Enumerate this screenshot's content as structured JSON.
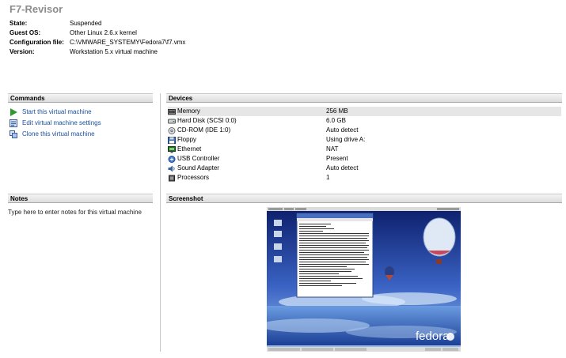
{
  "vm": {
    "name": "F7-Revisor",
    "info": [
      {
        "key": "State:",
        "value": "Suspended"
      },
      {
        "key": "Guest OS:",
        "value": "Other Linux 2.6.x kernel"
      },
      {
        "key": "Configuration file:",
        "value": "C:\\VMWARE_SYSTEMY\\Fedora7\\f7.vmx"
      },
      {
        "key": "Version:",
        "value": "Workstation 5.x virtual machine"
      }
    ]
  },
  "commands": {
    "header": "Commands",
    "items": [
      {
        "label": "Start this virtual machine",
        "icon": "play-icon"
      },
      {
        "label": "Edit virtual machine settings",
        "icon": "settings-icon"
      },
      {
        "label": "Clone this virtual machine",
        "icon": "clone-icon"
      }
    ]
  },
  "devices": {
    "header": "Devices",
    "items": [
      {
        "name": "Memory",
        "value": "256 MB",
        "icon": "memory-icon"
      },
      {
        "name": "Hard Disk (SCSI 0:0)",
        "value": "6.0 GB",
        "icon": "hard-disk-icon"
      },
      {
        "name": "CD-ROM (IDE 1:0)",
        "value": "Auto detect",
        "icon": "cdrom-icon"
      },
      {
        "name": "Floppy",
        "value": "Using drive A:",
        "icon": "floppy-icon"
      },
      {
        "name": "Ethernet",
        "value": "NAT",
        "icon": "ethernet-icon"
      },
      {
        "name": "USB Controller",
        "value": "Present",
        "icon": "usb-icon"
      },
      {
        "name": "Sound Adapter",
        "value": "Auto detect",
        "icon": "sound-icon"
      },
      {
        "name": "Processors",
        "value": "1",
        "icon": "processor-icon"
      }
    ]
  },
  "notes": {
    "header": "Notes",
    "placeholder": "Type here to enter notes for this virtual machine"
  },
  "screenshot": {
    "header": "Screenshot",
    "brand_text": "fedora"
  }
}
